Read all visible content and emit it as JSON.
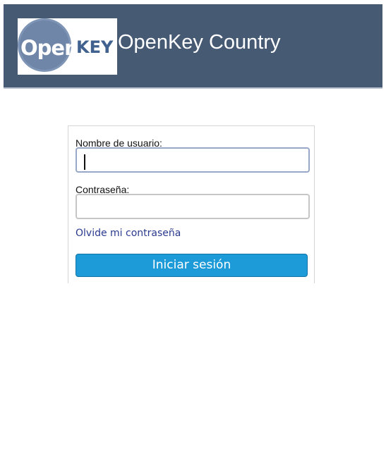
{
  "header": {
    "logo_text": "OpenKEY",
    "site_title": "OpenKey Country"
  },
  "login_form": {
    "username_label": "Nombre de usuario:",
    "username_value": "",
    "password_label": "Contraseña:",
    "password_value": "",
    "forgot_link": "Olvide mi contraseña",
    "submit_label": "Iniciar sesión"
  },
  "colors": {
    "header_bg": "#465a74",
    "button_bg": "#1d9ad8",
    "link": "#2a3a8f"
  }
}
